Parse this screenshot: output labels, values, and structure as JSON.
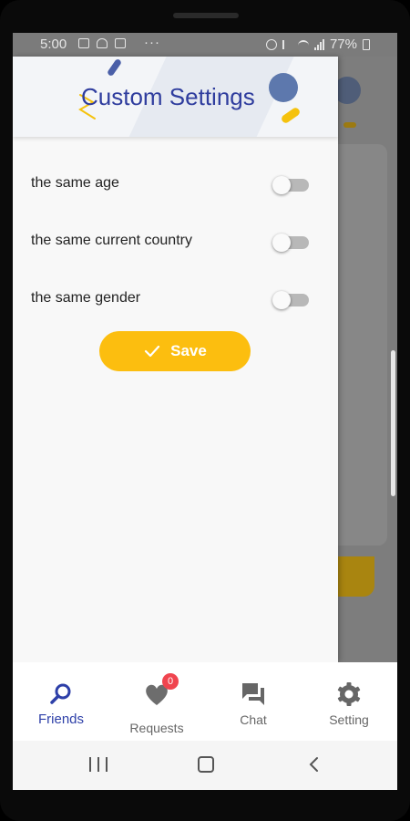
{
  "status_bar": {
    "time": "5:00",
    "dots": "···",
    "battery": "77%"
  },
  "drawer": {
    "title": "Custom Settings",
    "options": [
      {
        "label": "the same age",
        "enabled": false
      },
      {
        "label": "the same current country",
        "enabled": false
      },
      {
        "label": "the same gender",
        "enabled": false
      }
    ],
    "save_label": "Save"
  },
  "bottom_nav": {
    "items": [
      {
        "label": "Friends",
        "icon": "friends-search-icon",
        "active": true
      },
      {
        "label": "Requests",
        "icon": "heart-icon",
        "active": false,
        "badge": "0"
      },
      {
        "label": "Chat",
        "icon": "chat-icon",
        "active": false
      },
      {
        "label": "Setting",
        "icon": "gear-icon",
        "active": false
      }
    ]
  },
  "colors": {
    "title": "#2f3d9e",
    "accent_yellow": "#fcbe0f",
    "active_nav": "#2d3fa8",
    "inactive_nav": "#666666",
    "badge": "#f0454f"
  }
}
